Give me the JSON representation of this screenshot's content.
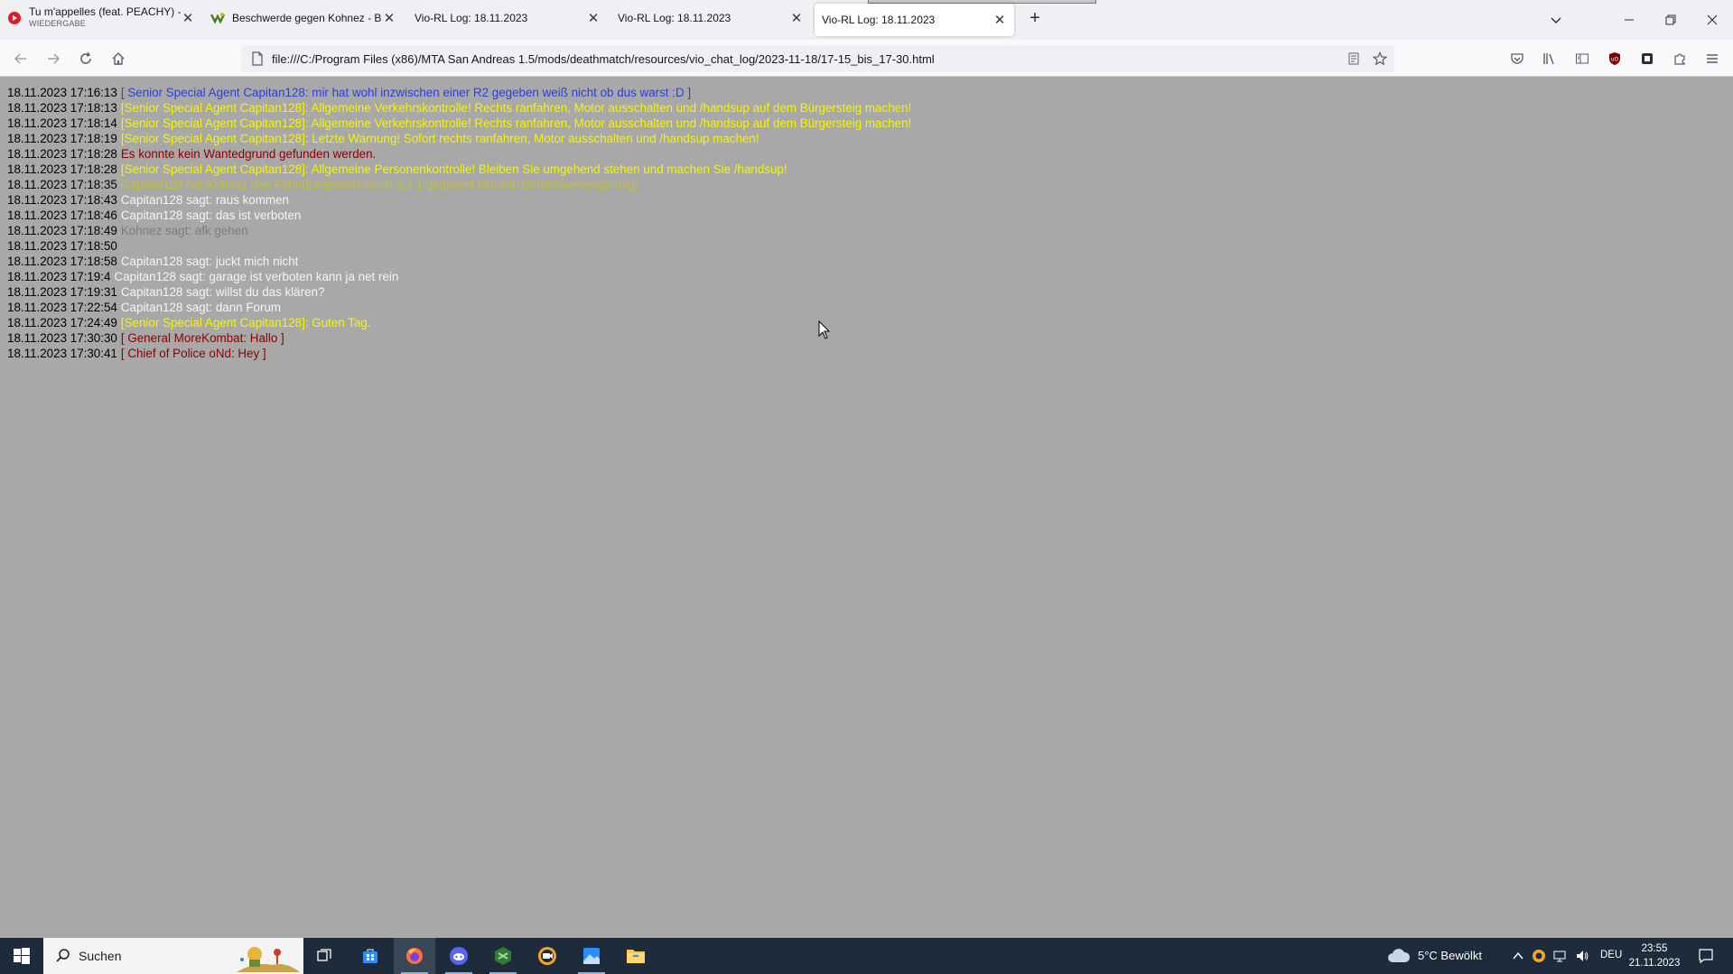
{
  "browser": {
    "tabs": [
      {
        "title": "Tu m'appelles (feat. PEACHY) -",
        "subtitle": "WIEDERGABE"
      },
      {
        "title": "Beschwerde gegen Kohnez - Be"
      },
      {
        "title": "Vio-RL Log: 18.11.2023"
      },
      {
        "title": "Vio-RL Log: 18.11.2023"
      },
      {
        "title": "Vio-RL Log: 18.11.2023"
      }
    ],
    "new_tab_label": "+",
    "url": "file:///C:/Program Files (x86)/MTA San Andreas 1.5/mods/deathmatch/resources/vio_chat_log/2023-11-18/17-15_bis_17-30.html"
  },
  "log": [
    {
      "time": "18.11.2023 17:16:13",
      "text": "[ Senior Special Agent Capitan128: mir hat wohl inzwischen einer R2 gegeben weiß nicht ob dus warst :D ]",
      "color": "blue"
    },
    {
      "time": "18.11.2023 17:18:13",
      "text": "[Senior Special Agent Capitan128]: Allgemeine Verkehrskontrolle! Rechts ranfahren, Motor ausschalten und /handsup auf dem Bürgersteig machen!",
      "color": "yellow"
    },
    {
      "time": "18.11.2023 17:18:14",
      "text": "[Senior Special Agent Capitan128]: Allgemeine Verkehrskontrolle! Rechts ranfahren, Motor ausschalten und /handsup auf dem Bürgersteig machen!",
      "color": "yellow"
    },
    {
      "time": "18.11.2023 17:18:19",
      "text": "[Senior Special Agent Capitan128]: Letzte Warnung! Sofort rechts ranfahren, Motor ausschalten und /handsup machen!",
      "color": "yellow"
    },
    {
      "time": "18.11.2023 17:18:28",
      "text": "Es konnte kein Wantedgrund gefunden werden.",
      "color": "darkred"
    },
    {
      "time": "18.11.2023 17:18:28",
      "text": "[Senior Special Agent Capitan128]: Allgemeine Personenkontrolle! Bleiben Sie umgehend stehen und machen Sie /handsup!",
      "color": "yellow"
    },
    {
      "time": "18.11.2023 17:18:35",
      "text": "Capitan128 hat Kohnez den Fahndungslevel von 0 auf 1 geändert (Grund: Befehlsverweigerung)",
      "color": "olive"
    },
    {
      "time": "18.11.2023 17:18:43",
      "text": "Capitan128 sagt: raus kommen",
      "color": "white"
    },
    {
      "time": "18.11.2023 17:18:46",
      "text": "Capitan128 sagt: das ist verboten",
      "color": "white"
    },
    {
      "time": "18.11.2023 17:18:49",
      "text": "Kohnez sagt: afk gehen",
      "color": "grey"
    },
    {
      "time": "18.11.2023 17:18:50",
      "text": "",
      "color": "white"
    },
    {
      "time": "18.11.2023 17:18:58",
      "text": "Capitan128 sagt: juckt mich nicht",
      "color": "white"
    },
    {
      "time": "18.11.2023 17:19:4",
      "text": "Capitan128 sagt: garage ist verboten kann ja net rein",
      "color": "white"
    },
    {
      "time": "18.11.2023 17:19:31",
      "text": "Capitan128 sagt: willst du das klären?",
      "color": "white"
    },
    {
      "time": "18.11.2023 17:22:54",
      "text": "Capitan128 sagt: dann Forum",
      "color": "white"
    },
    {
      "time": "18.11.2023 17:24:49",
      "text": "[Senior Special Agent Capitan128]: Guten Tag.",
      "color": "yellow"
    },
    {
      "time": "18.11.2023 17:30:30",
      "text": "[ General MoreKombat: Hallo ]",
      "color": "darkred"
    },
    {
      "time": "18.11.2023 17:30:41",
      "text": "[ Chief of Police oNd: Hey ]",
      "color": "darkred"
    }
  ],
  "taskbar": {
    "search_label": "Suchen",
    "weather": "5°C  Bewölkt",
    "language": "DEU",
    "time": "23:55",
    "date": "21.11.2023"
  },
  "colors": {
    "blue": "#2b3fd8",
    "yellow": "#f5f500",
    "darkred": "#8b0000",
    "olive": "#c0c040",
    "white": "#f5f5f5",
    "grey": "#7c7c7c",
    "page_bg": "#a8a8a8"
  }
}
